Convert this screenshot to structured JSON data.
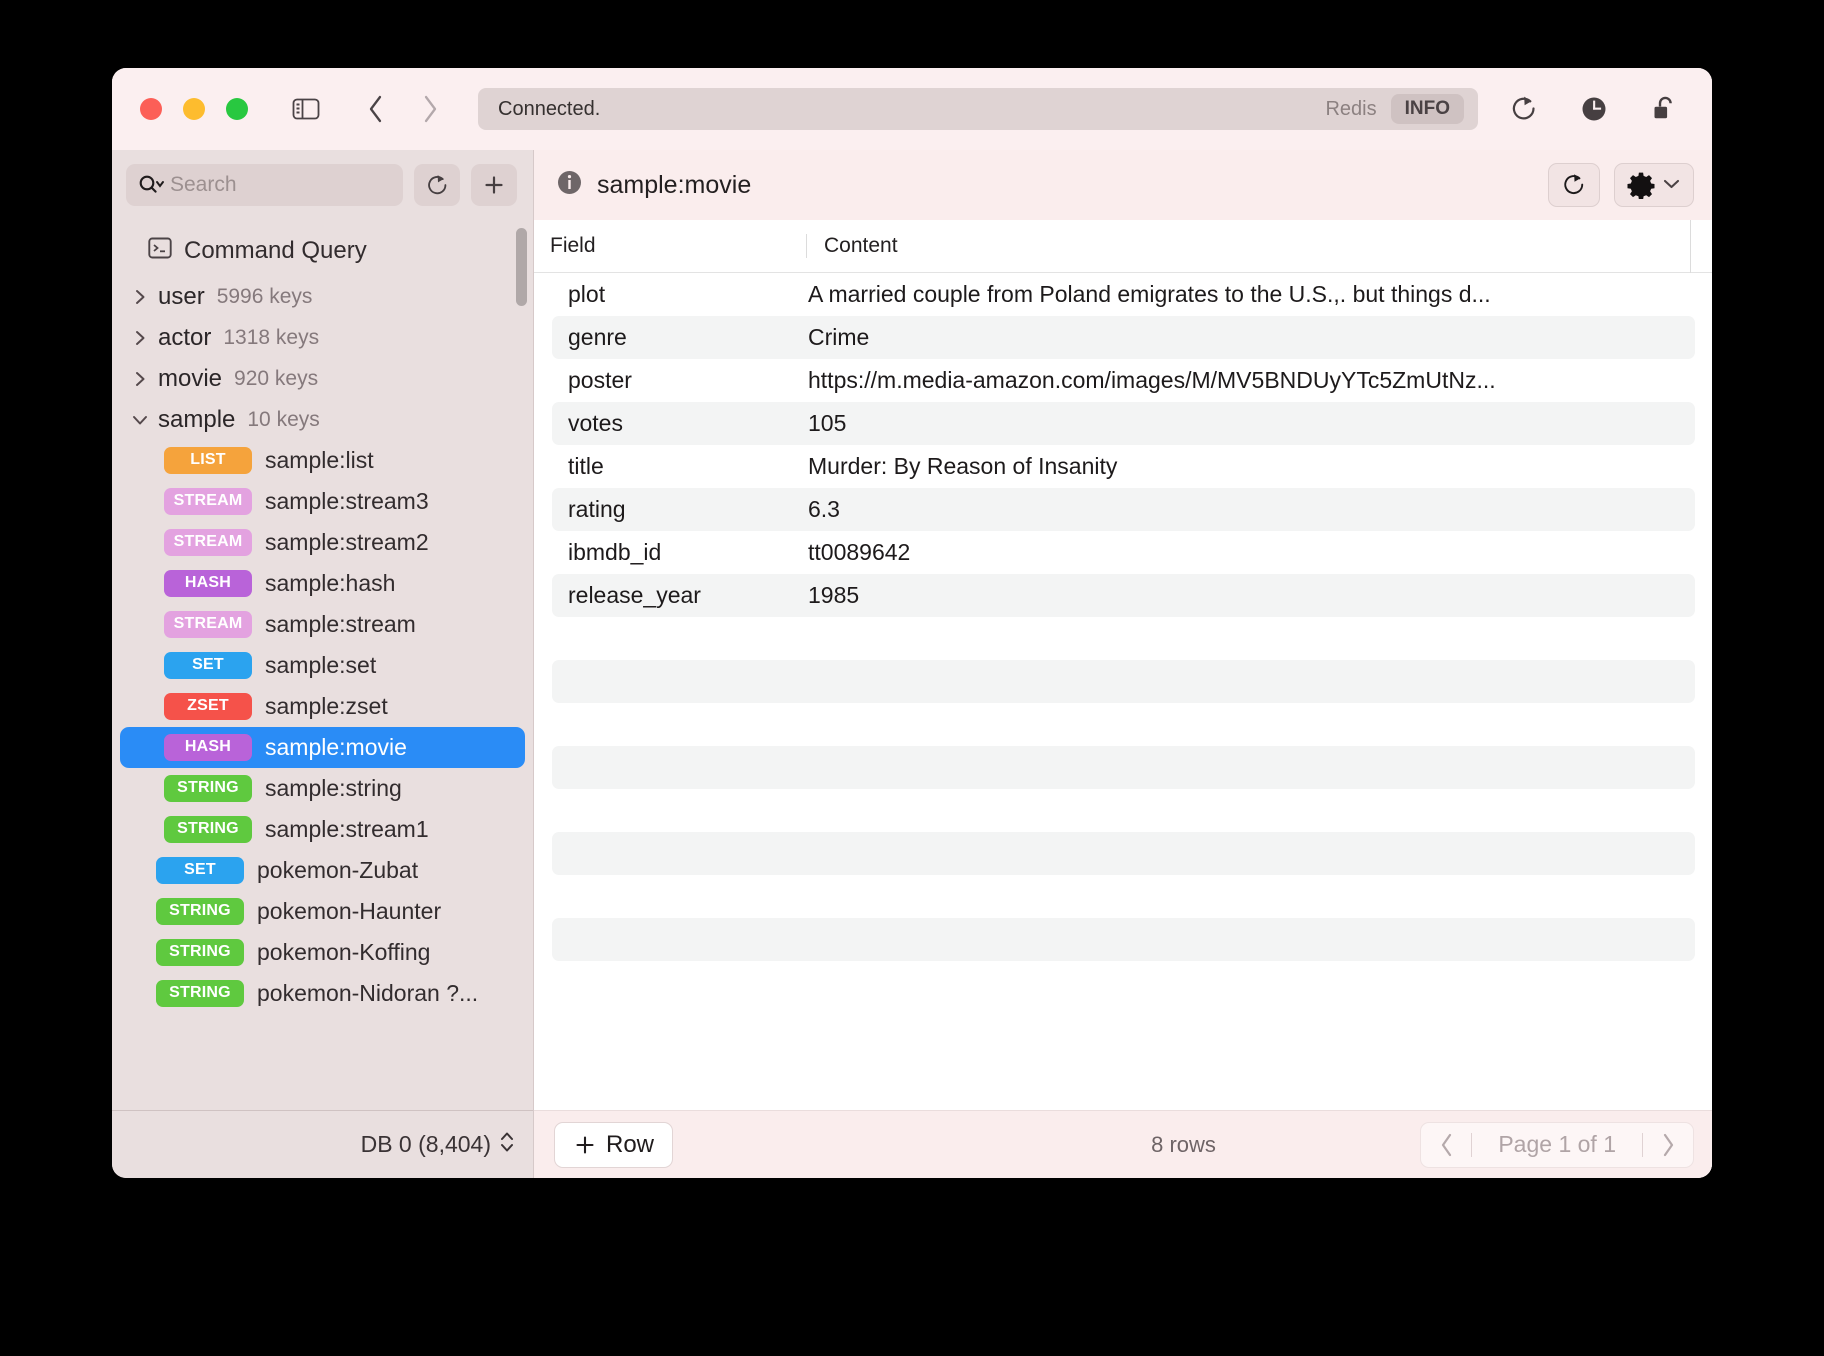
{
  "titlebar": {
    "status_text": "Connected.",
    "redis_label": "Redis",
    "info_badge": "INFO",
    "icons": {
      "sidebar_toggle": "sidebar-toggle-icon",
      "back": "chevron-left-icon",
      "forward": "chevron-right-icon",
      "refresh": "refresh-icon",
      "clock": "clock-icon",
      "unlock": "unlock-icon"
    }
  },
  "sidebar": {
    "search": {
      "placeholder": "Search"
    },
    "refresh_label": "refresh-icon",
    "add_label": "+",
    "command_query": "Command Query",
    "groups": [
      {
        "name": "user",
        "count": "5996 keys",
        "expanded": false
      },
      {
        "name": "actor",
        "count": "1318 keys",
        "expanded": false
      },
      {
        "name": "movie",
        "count": "920 keys",
        "expanded": false
      },
      {
        "name": "sample",
        "count": "10 keys",
        "expanded": true
      }
    ],
    "keys": [
      {
        "type": "LIST",
        "name": "sample:list",
        "level": 2,
        "selected": false
      },
      {
        "type": "STREAM",
        "name": "sample:stream3",
        "level": 2,
        "selected": false
      },
      {
        "type": "STREAM",
        "name": "sample:stream2",
        "level": 2,
        "selected": false
      },
      {
        "type": "HASH",
        "name": "sample:hash",
        "level": 2,
        "selected": false
      },
      {
        "type": "STREAM",
        "name": "sample:stream",
        "level": 2,
        "selected": false
      },
      {
        "type": "SET",
        "name": "sample:set",
        "level": 2,
        "selected": false
      },
      {
        "type": "ZSET",
        "name": "sample:zset",
        "level": 2,
        "selected": false
      },
      {
        "type": "HASH",
        "name": "sample:movie",
        "level": 2,
        "selected": true
      },
      {
        "type": "STRING",
        "name": "sample:string",
        "level": 2,
        "selected": false
      },
      {
        "type": "STRING",
        "name": "sample:stream1",
        "level": 2,
        "selected": false
      },
      {
        "type": "SET",
        "name": "pokemon-Zubat",
        "level": 1,
        "selected": false
      },
      {
        "type": "STRING",
        "name": "pokemon-Haunter",
        "level": 1,
        "selected": false
      },
      {
        "type": "STRING",
        "name": "pokemon-Koffing",
        "level": 1,
        "selected": false
      },
      {
        "type": "STRING",
        "name": "pokemon-Nidoran ?...",
        "level": 1,
        "selected": false
      }
    ],
    "db_selector": "DB 0 (8,404)"
  },
  "type_colors": {
    "LIST": "#f5a33c",
    "STREAM": "#e3a2e0",
    "HASH": "#b963d9",
    "SET": "#2ba3ef",
    "ZSET": "#f5524a",
    "STRING": "#5fc93f"
  },
  "main": {
    "title": "sample:movie",
    "info_icon": "info-icon",
    "refresh_icon": "refresh-icon",
    "settings_icon": "gear-icon",
    "columns": [
      "Field",
      "Content"
    ],
    "rows": [
      {
        "field": "plot",
        "content": "A married couple from Poland emigrates to the U.S.,. but things d..."
      },
      {
        "field": "genre",
        "content": "Crime"
      },
      {
        "field": "poster",
        "content": "https://m.media-amazon.com/images/M/MV5BNDUyYTc5ZmUtNz..."
      },
      {
        "field": "votes",
        "content": "105"
      },
      {
        "field": "title",
        "content": "Murder: By Reason of Insanity"
      },
      {
        "field": "rating",
        "content": "6.3"
      },
      {
        "field": "ibmdb_id",
        "content": "tt0089642"
      },
      {
        "field": "release_year",
        "content": "1985"
      }
    ],
    "empty_row_count": 9,
    "add_row_label": "Row",
    "rows_count": "8 rows",
    "pager_label": "Page 1 of 1"
  },
  "colors": {
    "accent": "#2a8cf6",
    "titlebar_bg": "#fbeff0",
    "sidebar_bg": "#e9dfdf",
    "main_bg": "#ffffff",
    "stripe": "#f3f4f4"
  }
}
